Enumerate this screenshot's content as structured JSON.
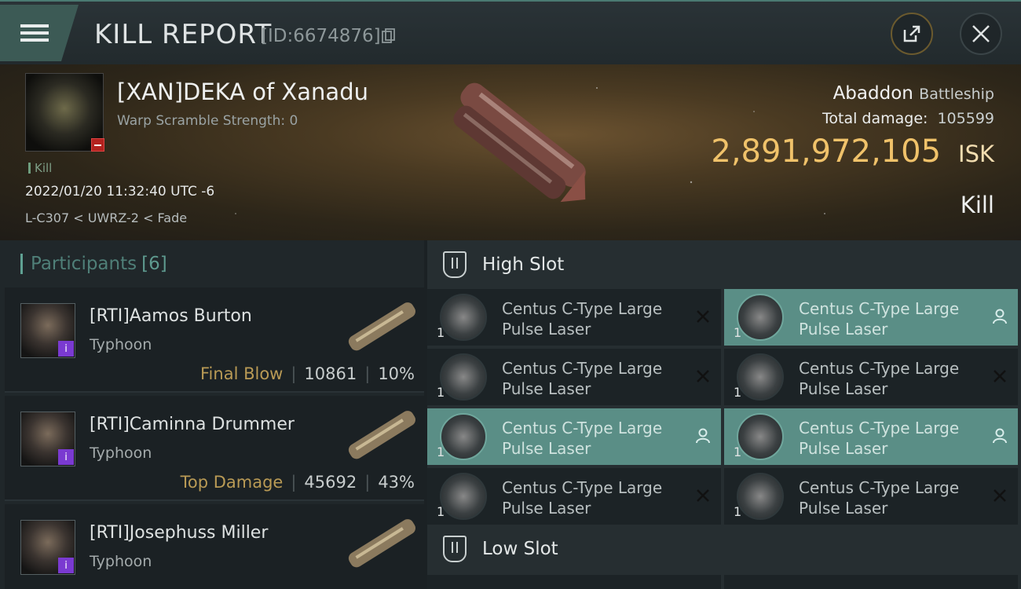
{
  "header": {
    "title": "KILL REPORT",
    "report_id": "[ID:6674876]"
  },
  "victim": {
    "name": "[XAN]DEKA of Xanadu",
    "warp_scramble": "Warp Scramble Strength: 0",
    "tag": "Kill",
    "time": "2022/01/20 11:32:40 UTC -6",
    "location": "L-C307 < UWRZ-2 < Fade",
    "ship_name": "Abaddon",
    "ship_class": "Battleship",
    "total_damage_label": "Total damage:",
    "total_damage": "105599",
    "isk_value": "2,891,972,105",
    "isk_unit": "ISK",
    "result": "Kill"
  },
  "participants": {
    "label": "Participants",
    "count": "[6]",
    "items": [
      {
        "name": "[RTI]Aamos Burton",
        "ship": "Typhoon",
        "badge": "i",
        "label": "Final Blow",
        "damage": "10861",
        "percent": "10%"
      },
      {
        "name": "[RTI]Caminna Drummer",
        "ship": "Typhoon",
        "badge": "i",
        "label": "Top Damage",
        "damage": "45692",
        "percent": "43%"
      },
      {
        "name": "[RTI]Josephuss Miller",
        "ship": "Typhoon",
        "badge": "i",
        "label": "",
        "damage": "",
        "percent": ""
      }
    ]
  },
  "fitting": {
    "high_slot_label": "High Slot",
    "low_slot_label": "Low Slot",
    "modules": [
      {
        "line1": "Centus C-Type Large",
        "line2": "Pulse Laser",
        "qty": "1",
        "state": "destroyed"
      },
      {
        "line1": "Centus C-Type Large",
        "line2": "Pulse Laser",
        "qty": "1",
        "state": "dropped"
      },
      {
        "line1": "Centus C-Type Large",
        "line2": "Pulse Laser",
        "qty": "1",
        "state": "destroyed"
      },
      {
        "line1": "Centus C-Type Large",
        "line2": "Pulse Laser",
        "qty": "1",
        "state": "destroyed"
      },
      {
        "line1": "Centus C-Type Large",
        "line2": "Pulse Laser",
        "qty": "1",
        "state": "dropped"
      },
      {
        "line1": "Centus C-Type Large",
        "line2": "Pulse Laser",
        "qty": "1",
        "state": "dropped"
      },
      {
        "line1": "Centus C-Type Large",
        "line2": "Pulse Laser",
        "qty": "1",
        "state": "destroyed"
      },
      {
        "line1": "Centus C-Type Large",
        "line2": "Pulse Laser",
        "qty": "1",
        "state": "destroyed"
      }
    ]
  },
  "colors": {
    "accent_teal": "#5a8e86",
    "isk_gold": "#f0c26a",
    "badge_purple": "#7a3ad1",
    "victim_badge_red": "#b3221e"
  }
}
